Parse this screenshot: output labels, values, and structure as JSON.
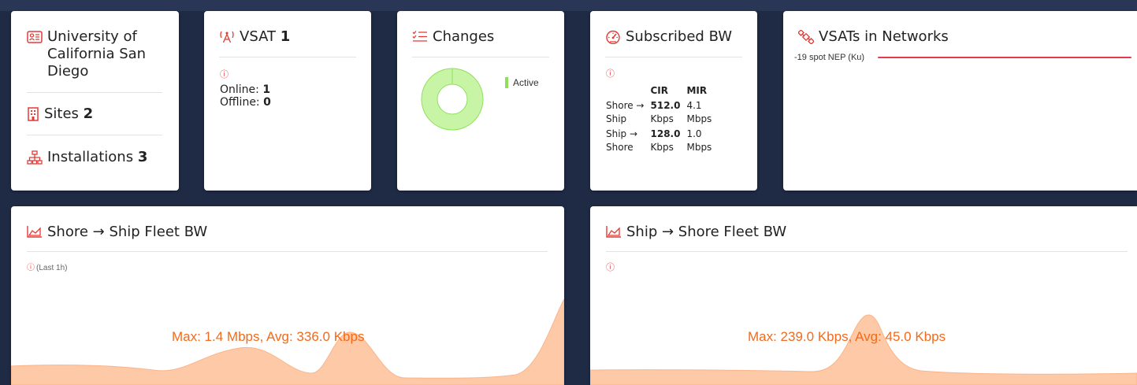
{
  "org_card": {
    "name": "University of California San Diego",
    "sites_label": "Sites",
    "sites_count": "2",
    "installations_label": "Installations",
    "installations_count": "3"
  },
  "vsat_card": {
    "title": "VSAT",
    "count": "1",
    "info_icon": "ⓘ",
    "online_label": "Online:",
    "online_value": "1",
    "offline_label": "Offline:",
    "offline_value": "0"
  },
  "changes_card": {
    "title": "Changes",
    "legend_label": "Active",
    "donut_color": "#c8f5a5",
    "donut_stroke": "#8ee05a"
  },
  "subscribed_card": {
    "title": "Subscribed BW",
    "info_icon": "ⓘ",
    "headers": [
      "CIR",
      "MIR"
    ],
    "rows": [
      {
        "label_line1": "Shore →",
        "label_line2": "Ship",
        "cir_value": "512.0",
        "cir_unit": "Kbps",
        "mir_value": "4.1",
        "mir_unit": "Mbps"
      },
      {
        "label_line1": "Ship →",
        "label_line2": "Shore",
        "cir_value": "128.0",
        "cir_unit": "Kbps",
        "mir_value": "1.0",
        "mir_unit": "Mbps"
      }
    ]
  },
  "networks_card": {
    "title": "VSATs in Networks",
    "bar_label": "-19 spot NEP (Ku)",
    "bar_color": "#e53950"
  },
  "shore_ship_card": {
    "title": "Shore → Ship Fleet BW",
    "info_icon": "ⓘ",
    "period": "(Last 1h)",
    "summary": "Max: 1.4 Mbps, Avg: 336.0 Kbps"
  },
  "ship_shore_card": {
    "title": "Ship → Shore Fleet BW",
    "info_icon": "ⓘ",
    "summary": "Max: 239.0 Kbps, Avg: 45.0 Kbps"
  },
  "colors": {
    "accent_red": "#e53935",
    "area_fill": "#fdc9a6",
    "area_stroke": "#fbb48a",
    "summary_text": "#f26a1b"
  },
  "icons": {
    "org": "id-card-icon",
    "sites": "building-icon",
    "installations": "sitemap-icon",
    "vsat": "satellite-dish-icon",
    "changes": "checklist-icon",
    "subscribed": "speedometer-icon",
    "networks": "satellite-icon",
    "fleet_bw": "area-chart-icon"
  }
}
